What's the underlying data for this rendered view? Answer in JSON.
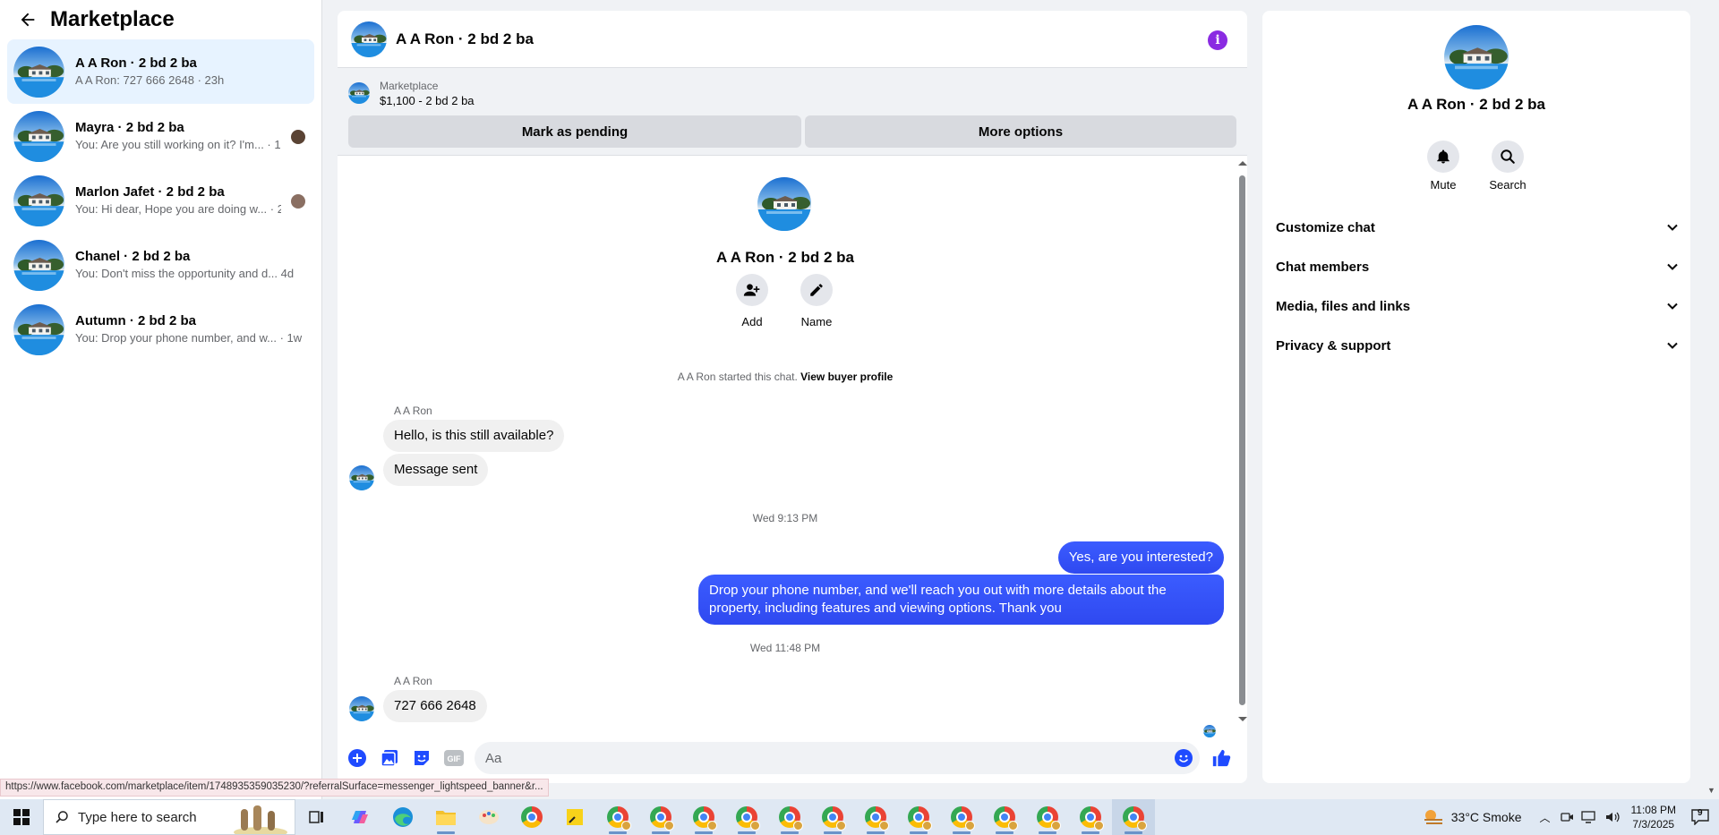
{
  "sidebar": {
    "title": "Marketplace",
    "conversations": [
      {
        "title": "A A Ron · 2 bd 2 ba",
        "preview": "A A Ron: 727 666 2648 · 23h"
      },
      {
        "title": "Mayra · 2 bd 2 ba",
        "preview": "You: Are you still working on it? I'm... · 1d"
      },
      {
        "title": "Marlon Jafet · 2 bd 2 ba",
        "preview": "You: Hi dear, Hope you are doing w... · 2d"
      },
      {
        "title": "Chanel · 2 bd 2 ba",
        "preview": "You: Don't miss the opportunity and d... 4d"
      },
      {
        "title": "Autumn · 2 bd 2 ba",
        "preview": "You: Drop your phone number, and w... · 1w"
      }
    ]
  },
  "chat": {
    "title": "A A Ron · 2 bd 2 ba",
    "listing": {
      "label": "Marketplace",
      "price": "$1,100 - 2 bd 2 ba",
      "pending_label": "Mark as pending",
      "more_label": "More options"
    },
    "intro": {
      "name": "A A Ron · 2 bd 2 ba",
      "add_label": "Add",
      "name_label": "Name",
      "started_text": "A A Ron started this chat.",
      "profile_link": "View buyer profile"
    },
    "messages": {
      "sender1": "A A Ron",
      "m1": "Hello, is this still available?",
      "m2": "Message sent",
      "time1": "Wed 9:13 PM",
      "out1": "Yes, are you interested?",
      "out2": "Drop your phone number, and we'll reach you out with more details about the property, including features and viewing options.  Thank you",
      "time2": "Wed 11:48 PM",
      "sender2": "A A Ron",
      "m3": "727 666 2648"
    },
    "composer_placeholder": "Aa"
  },
  "info_panel": {
    "name": "A A Ron · 2 bd 2 ba",
    "mute_label": "Mute",
    "search_label": "Search",
    "sections": [
      "Customize chat",
      "Chat members",
      "Media, files and links",
      "Privacy & support"
    ]
  },
  "status_url": "https://www.facebook.com/marketplace/item/1748935359035230/?referralSurface=messenger_lightspeed_banner&r...",
  "taskbar": {
    "search_placeholder": "Type here to search",
    "weather": "33°C  Smoke",
    "time": "11:08 PM",
    "date": "7/3/2025",
    "notifications": "9"
  },
  "colors": {
    "accent": "#3b5cff",
    "active_conv": "#e7f3ff",
    "info_icon": "#8a2be2"
  }
}
